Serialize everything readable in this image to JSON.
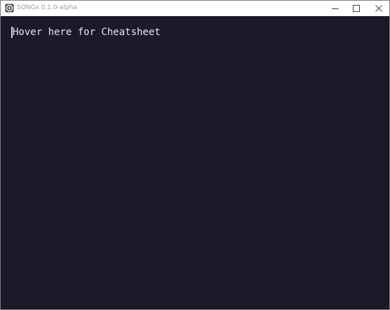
{
  "window": {
    "title": "SONGx 0.1.0-alpha",
    "controls": {
      "minimize": "minimize-icon",
      "maximize": "maximize-icon",
      "close": "close-icon"
    }
  },
  "editor": {
    "hint_text": "Hover here for Cheatsheet"
  },
  "colors": {
    "background": "#1b1a29",
    "titlebar": "#ffffff",
    "text": "#e4e4ee"
  }
}
